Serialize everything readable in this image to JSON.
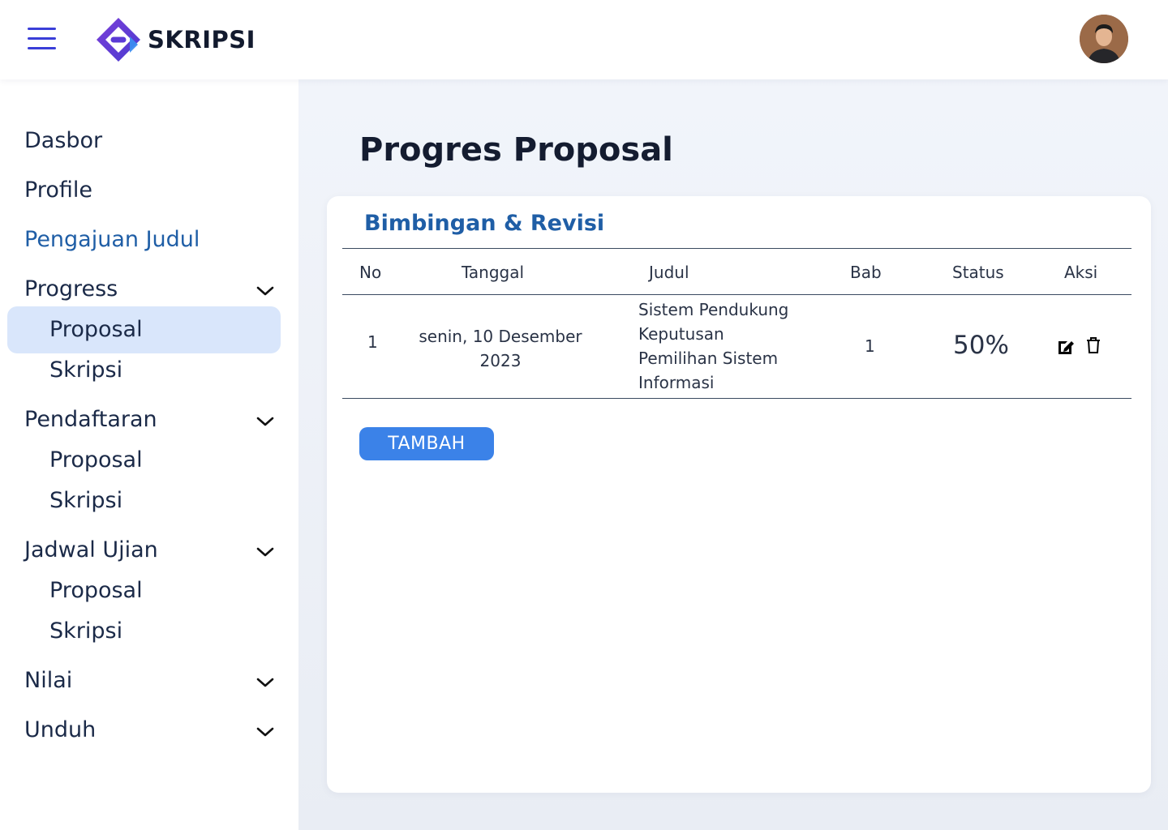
{
  "header": {
    "brand_name": "SKRIPSI",
    "icons": {
      "menu": "hamburger-menu-icon",
      "logo": "brand-logo-icon",
      "avatar": "user-avatar"
    },
    "colors": {
      "menu_icon": "#3a3ed8",
      "logo_primary": "#5b3ad6",
      "logo_secondary": "#3b8cf0"
    }
  },
  "sidebar": {
    "items": [
      {
        "label": "Dasbor"
      },
      {
        "label": "Profile"
      },
      {
        "label": "Pengajuan Judul"
      },
      {
        "label": "Progress",
        "expanded_icon": "chevron-down-icon",
        "children": [
          {
            "label": "Proposal",
            "active": true
          },
          {
            "label": "Skripsi"
          }
        ]
      },
      {
        "label": "Pendaftaran",
        "expanded_icon": "chevron-down-icon",
        "children": [
          {
            "label": "Proposal"
          },
          {
            "label": "Skripsi"
          }
        ]
      },
      {
        "label": "Jadwal Ujian",
        "expanded_icon": "chevron-down-icon",
        "children": [
          {
            "label": "Proposal"
          },
          {
            "label": "Skripsi"
          }
        ]
      },
      {
        "label": "Nilai",
        "expanded_icon": "chevron-down-icon"
      },
      {
        "label": "Unduh",
        "expanded_icon": "chevron-down-icon"
      }
    ],
    "colors": {
      "link": "#1f5ea6",
      "active_bg": "#d9e6fb"
    }
  },
  "main": {
    "page_title": "Progres Proposal",
    "card": {
      "title": "Bimbingan & Revisi",
      "table": {
        "headers": [
          "No",
          "Tanggal",
          "Judul",
          "Bab",
          "Status",
          "Aksi"
        ],
        "rows": [
          {
            "no": "1",
            "tanggal": [
              "senin, 10 Desember",
              "2023"
            ],
            "judul": [
              "Sistem Pendukung",
              "Keputusan",
              "Pemilihan Sistem",
              "Informasi"
            ],
            "bab": "1",
            "status": "50%",
            "aksi": [
              "edit-icon",
              "trash-icon"
            ]
          }
        ]
      },
      "add_button": {
        "label": "TAMBAH",
        "color": "#3b82e8"
      }
    }
  }
}
